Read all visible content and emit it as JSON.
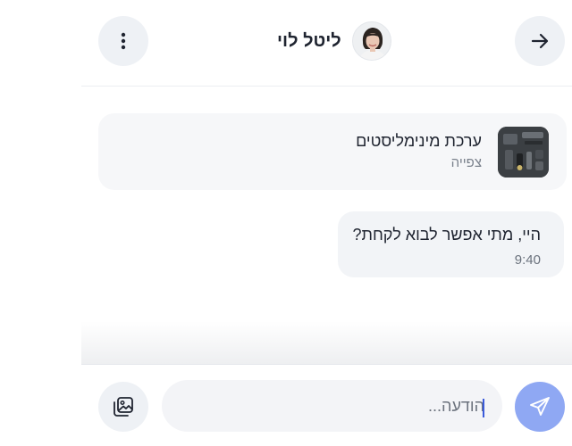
{
  "header": {
    "contact_name": "ליטל לוי",
    "menu_icon": "more-vertical-icon",
    "back_icon": "arrow-right-icon",
    "avatar": "user-avatar"
  },
  "listing": {
    "title": "ערכת מינימליסטים",
    "status": "צפייה",
    "thumbnail": "product-thumbnail"
  },
  "messages": [
    {
      "text": "היי, מתי אפשר לבוא לקחת?",
      "time": "9:40"
    }
  ],
  "composer": {
    "placeholder": "הודעה...",
    "attach_icon": "image-gallery-icon",
    "send_icon": "send-icon"
  },
  "colors": {
    "accent": "#8fa8f3",
    "button_bg": "#eef1f5",
    "bubble_bg": "#f2f4f7",
    "card_bg": "#f6f7f9",
    "text": "#1f2430",
    "muted": "#7a818c"
  }
}
